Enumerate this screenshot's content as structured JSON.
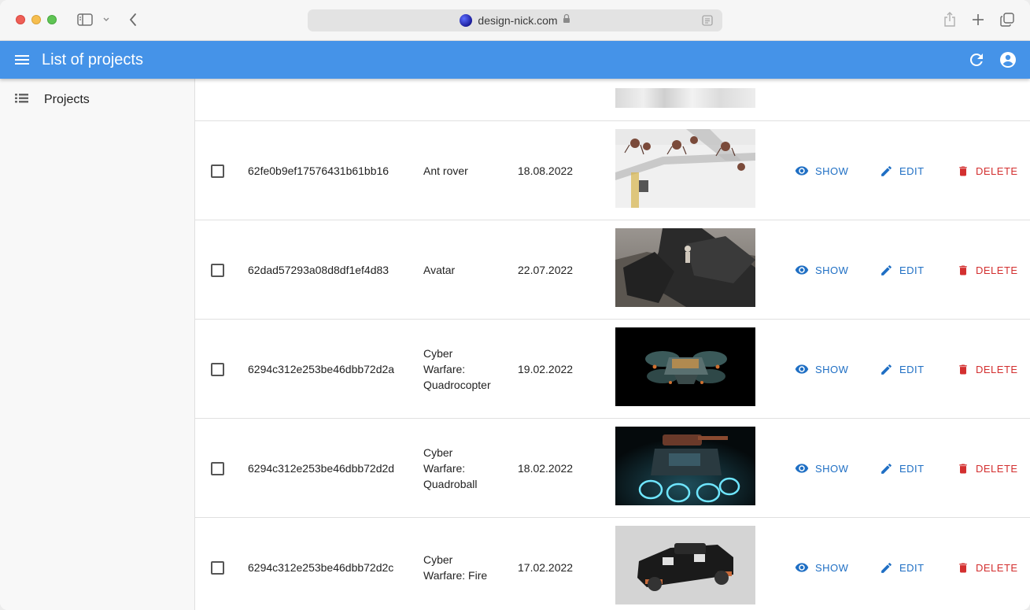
{
  "browser": {
    "url": "design-nick.com"
  },
  "appbar": {
    "title": "List of projects"
  },
  "sidebar": {
    "items": [
      {
        "label": "Projects"
      }
    ]
  },
  "actions": {
    "show": "SHOW",
    "edit": "EDIT",
    "delete": "DELETE"
  },
  "rows": [
    {
      "id": "62fe0b9ef17576431b61bb16",
      "name": [
        "Ant rover"
      ],
      "date": "18.08.2022",
      "thumb": "ant-rover"
    },
    {
      "id": "62dad57293a08d8df1ef4d83",
      "name": [
        "Avatar"
      ],
      "date": "22.07.2022",
      "thumb": "avatar"
    },
    {
      "id": "6294c312e253be46dbb72d2a",
      "name": [
        "Cyber",
        "Warfare:",
        "Quadrocopter"
      ],
      "date": "19.02.2022",
      "thumb": "quadrocopter"
    },
    {
      "id": "6294c312e253be46dbb72d2d",
      "name": [
        "Cyber",
        "Warfare:",
        "Quadroball"
      ],
      "date": "18.02.2022",
      "thumb": "quadroball"
    },
    {
      "id": "6294c312e253be46dbb72d2c",
      "name": [
        "Cyber",
        "Warfare: Fire"
      ],
      "date": "17.02.2022",
      "thumb": "fire"
    }
  ]
}
